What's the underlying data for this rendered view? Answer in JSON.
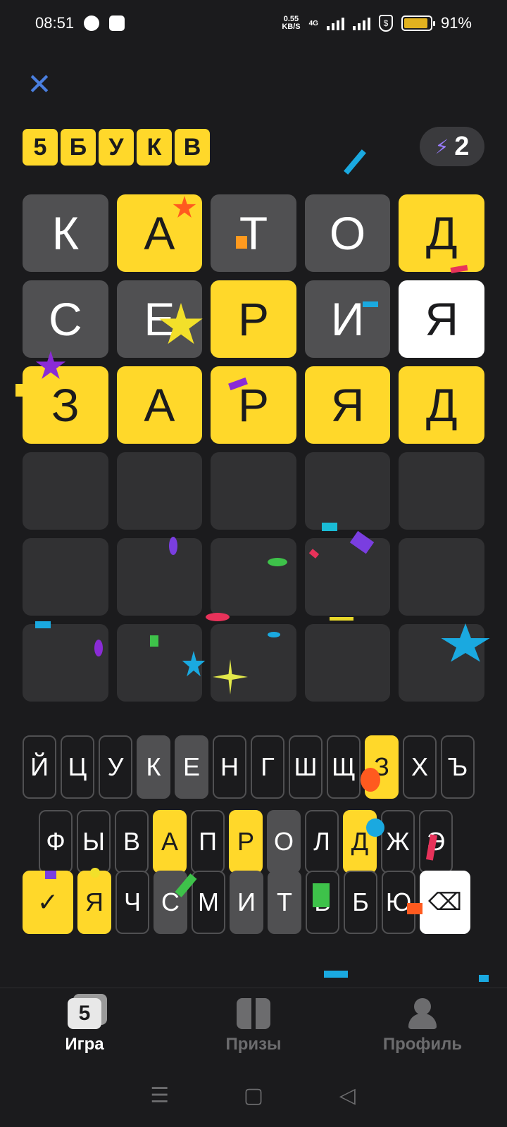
{
  "status_bar": {
    "time": "08:51",
    "net_speed_top": "0.55",
    "net_speed_bottom": "KB/S",
    "network": "4G",
    "battery": "91%"
  },
  "header": {
    "close_symbol": "✕",
    "logo_letters": [
      "5",
      "Б",
      "У",
      "К",
      "В"
    ],
    "hints_count": "2",
    "bolt_symbol": "⚡"
  },
  "board": {
    "rows": [
      [
        {
          "letter": "К",
          "state": "absent"
        },
        {
          "letter": "А",
          "state": "present"
        },
        {
          "letter": "Т",
          "state": "absent"
        },
        {
          "letter": "О",
          "state": "absent"
        },
        {
          "letter": "Д",
          "state": "correct"
        }
      ],
      [
        {
          "letter": "С",
          "state": "absent"
        },
        {
          "letter": "Е",
          "state": "absent"
        },
        {
          "letter": "Р",
          "state": "correct"
        },
        {
          "letter": "И",
          "state": "absent"
        },
        {
          "letter": "Я",
          "state": "white"
        }
      ],
      [
        {
          "letter": "З",
          "state": "correct"
        },
        {
          "letter": "А",
          "state": "correct"
        },
        {
          "letter": "Р",
          "state": "correct"
        },
        {
          "letter": "Я",
          "state": "correct"
        },
        {
          "letter": "Д",
          "state": "correct"
        }
      ],
      [
        {
          "letter": "",
          "state": "empty"
        },
        {
          "letter": "",
          "state": "empty"
        },
        {
          "letter": "",
          "state": "empty"
        },
        {
          "letter": "",
          "state": "empty"
        },
        {
          "letter": "",
          "state": "empty"
        }
      ],
      [
        {
          "letter": "",
          "state": "empty"
        },
        {
          "letter": "",
          "state": "empty"
        },
        {
          "letter": "",
          "state": "empty"
        },
        {
          "letter": "",
          "state": "empty"
        },
        {
          "letter": "",
          "state": "empty"
        }
      ],
      [
        {
          "letter": "",
          "state": "empty"
        },
        {
          "letter": "",
          "state": "empty"
        },
        {
          "letter": "",
          "state": "empty"
        },
        {
          "letter": "",
          "state": "empty"
        },
        {
          "letter": "",
          "state": "empty"
        }
      ]
    ]
  },
  "keyboard": {
    "row1": [
      {
        "key": "Й",
        "state": "unused"
      },
      {
        "key": "Ц",
        "state": "unused"
      },
      {
        "key": "У",
        "state": "unused"
      },
      {
        "key": "К",
        "state": "absent"
      },
      {
        "key": "Е",
        "state": "absent"
      },
      {
        "key": "Н",
        "state": "unused"
      },
      {
        "key": "Г",
        "state": "unused"
      },
      {
        "key": "Ш",
        "state": "unused"
      },
      {
        "key": "Щ",
        "state": "unused"
      },
      {
        "key": "З",
        "state": "hit"
      },
      {
        "key": "Х",
        "state": "unused"
      },
      {
        "key": "Ъ",
        "state": "unused"
      }
    ],
    "row2": [
      {
        "key": "Ф",
        "state": "unused"
      },
      {
        "key": "Ы",
        "state": "unused"
      },
      {
        "key": "В",
        "state": "unused"
      },
      {
        "key": "А",
        "state": "hit"
      },
      {
        "key": "П",
        "state": "unused"
      },
      {
        "key": "Р",
        "state": "hit"
      },
      {
        "key": "О",
        "state": "absent"
      },
      {
        "key": "Л",
        "state": "unused"
      },
      {
        "key": "Д",
        "state": "hit"
      },
      {
        "key": "Ж",
        "state": "unused"
      },
      {
        "key": "Э",
        "state": "unused"
      }
    ],
    "row3": [
      {
        "key": "Я",
        "state": "hit"
      },
      {
        "key": "Ч",
        "state": "unused"
      },
      {
        "key": "С",
        "state": "absent"
      },
      {
        "key": "М",
        "state": "unused"
      },
      {
        "key": "И",
        "state": "absent"
      },
      {
        "key": "Т",
        "state": "absent"
      },
      {
        "key": "Ь",
        "state": "unused"
      },
      {
        "key": "Б",
        "state": "unused"
      },
      {
        "key": "Ю",
        "state": "unused"
      }
    ],
    "enter_symbol": "✓",
    "backspace_symbol": "⌫"
  },
  "bottom_nav": {
    "game_label": "Игра",
    "game_icon_text": "5",
    "prizes_label": "Призы",
    "profile_label": "Профиль"
  },
  "system_nav": {
    "menu": "☰",
    "home": "▢",
    "back": "◁"
  },
  "colors": {
    "background": "#1b1b1d",
    "yellow": "#ffd82a",
    "absent_gray": "#505052",
    "empty_cell": "#313133",
    "close_blue": "#4a7fe0"
  }
}
